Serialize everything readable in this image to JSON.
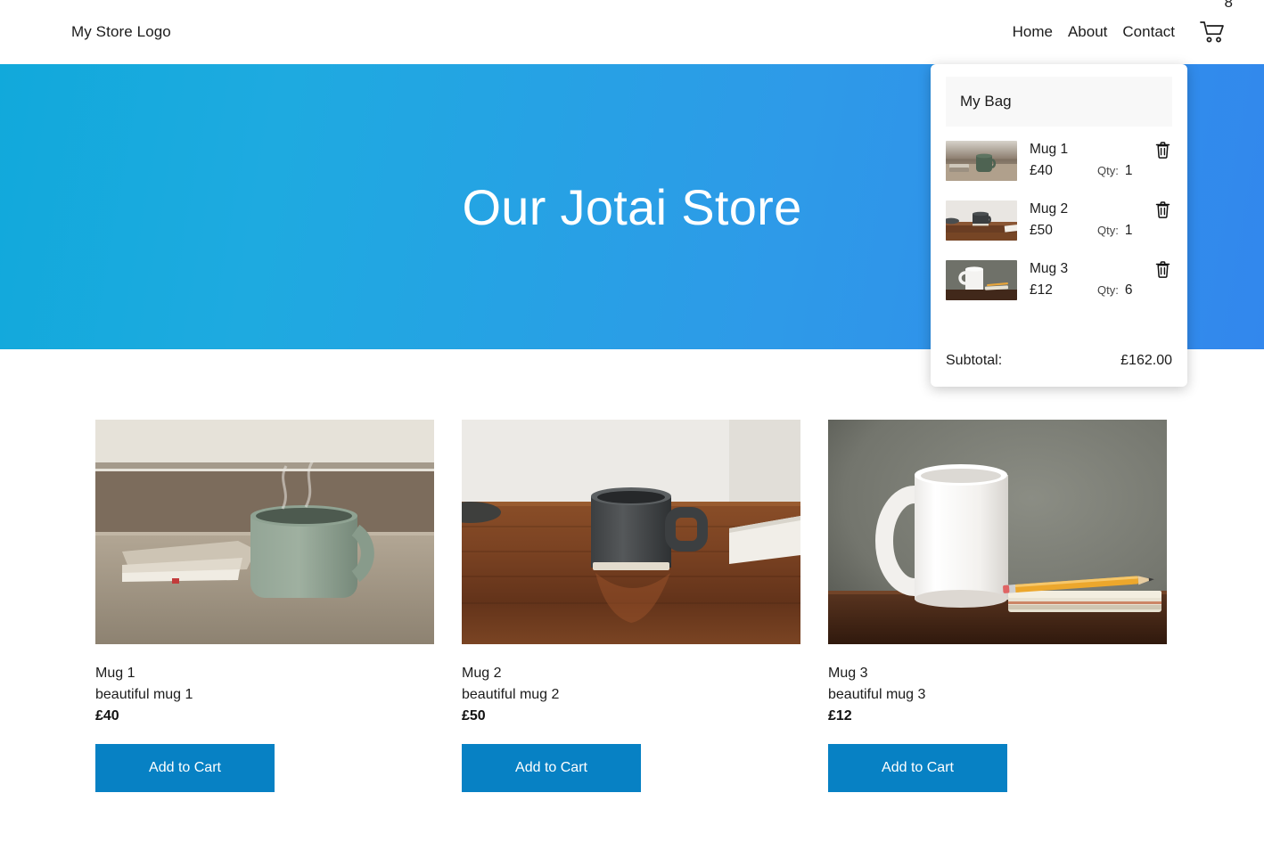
{
  "header": {
    "logo": "My Store Logo",
    "nav": [
      {
        "label": "Home"
      },
      {
        "label": "About"
      },
      {
        "label": "Contact"
      }
    ],
    "cart_icon": "shopping-cart-icon",
    "cart_badge_count": "8"
  },
  "hero": {
    "title": "Our Jotai Store",
    "gradient_from": "#11a9db",
    "gradient_to": "#3287ed"
  },
  "cart_panel": {
    "title": "My Bag",
    "qty_label": "Qty:",
    "delete_icon": "trash-icon",
    "items": [
      {
        "name": "Mug 1",
        "price": "£40",
        "qty": "1",
        "image": "green-mug-thumbnail"
      },
      {
        "name": "Mug 2",
        "price": "£50",
        "qty": "1",
        "image": "black-mug-thumbnail"
      },
      {
        "name": "Mug 3",
        "price": "£12",
        "qty": "6",
        "image": "white-mug-thumbnail"
      }
    ],
    "subtotal_label": "Subtotal:",
    "subtotal_value": "£162.00"
  },
  "products": {
    "add_to_cart_label": "Add to Cart",
    "button_color": "#0781c4",
    "items": [
      {
        "name": "Mug 1",
        "description": "beautiful mug 1",
        "price": "£40",
        "image": "green-mug-on-table-photo"
      },
      {
        "name": "Mug 2",
        "description": "beautiful mug 2",
        "price": "£50",
        "image": "black-mug-on-wood-desk-photo"
      },
      {
        "name": "Mug 3",
        "description": "beautiful mug 3",
        "price": "£12",
        "image": "white-mug-with-notebook-photo"
      }
    ]
  }
}
